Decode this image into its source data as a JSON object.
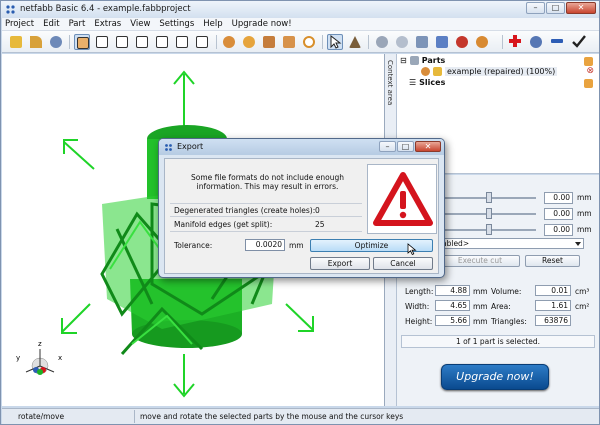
{
  "app": {
    "title": "netfabb Basic 6.4 - example.fabbproject",
    "menu": [
      "Project",
      "Edit",
      "Part",
      "Extras",
      "View",
      "Settings",
      "Help",
      "Upgrade now!"
    ]
  },
  "viewport": {
    "axes": {
      "x": "x",
      "y": "y",
      "z": "z"
    }
  },
  "side_tab": {
    "label": "Context area"
  },
  "tree": {
    "parts_label": "Parts",
    "part_name": "example (repaired) (100%)",
    "slices_label": "Slices"
  },
  "props": {
    "sliders": [
      {
        "value": "0.00",
        "unit": "mm",
        "level": 0.65
      },
      {
        "value": "0.00",
        "unit": "mm",
        "level": 0.65
      },
      {
        "value": "0.00",
        "unit": "mm",
        "level": 0.65
      }
    ],
    "combo_value": "abled>",
    "execute_cut": "Execute cut",
    "reset": "Reset",
    "length_label": "Length:",
    "length_value": "4.88",
    "length_unit": "mm",
    "width_label": "Width:",
    "width_value": "4.65",
    "width_unit": "mm",
    "height_label": "Height:",
    "height_value": "5.66",
    "height_unit": "mm",
    "volume_label": "Volume:",
    "volume_value": "0.01",
    "volume_unit": "cm³",
    "area_label": "Area:",
    "area_value": "1.61",
    "area_unit": "cm²",
    "triangles_label": "Triangles:",
    "triangles_value": "63876",
    "selection_status": "1 of 1 part is selected.",
    "upgrade_label": "Upgrade now!"
  },
  "statusbar": {
    "mode": "rotate/move",
    "hint": "move and rotate the selected parts by the mouse and the cursor keys"
  },
  "dialog": {
    "title": "Export",
    "message": "Some file formats do not include enough information. This may result in errors.",
    "degenerated_label": "Degenerated triangles (create holes):",
    "degenerated_value": "0",
    "manifold_label": "Manifold edges (get split):",
    "manifold_value": "25",
    "tolerance_label": "Tolerance:",
    "tolerance_value": "0.0020",
    "tolerance_unit": "mm",
    "optimize_label": "Optimize",
    "export_label": "Export",
    "cancel_label": "Cancel"
  },
  "colors": {
    "model_green": "#22c12a",
    "arrow_green": "#1fd428",
    "warning_red": "#d4141d",
    "upgrade_blue": "#1560ab"
  }
}
